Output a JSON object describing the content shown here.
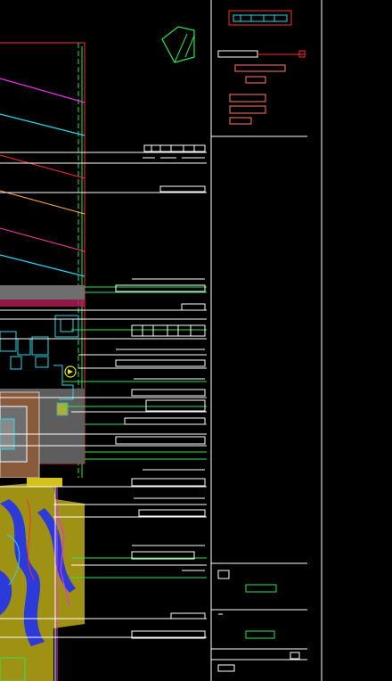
{
  "window": {
    "background": "#000000"
  },
  "title_block": {
    "header_label": "",
    "project_lines": [],
    "drawing_no_label": "",
    "drawing_name": "",
    "scale_label": ""
  },
  "colors": {
    "white": "#ffffff",
    "red": "#ff2a2a",
    "green": "#27e64f",
    "cyan": "#25d9e6",
    "magenta": "#e632e6",
    "yellow": "#e6e61f",
    "blue": "#2b3ad9",
    "grey_fill": "#6e6e6e",
    "salmon": "#ff7a6a",
    "pink": "#ff3ca6"
  },
  "icons": {
    "north_arrow": "north-arrow-icon",
    "section_marker": "section-marker-icon"
  }
}
